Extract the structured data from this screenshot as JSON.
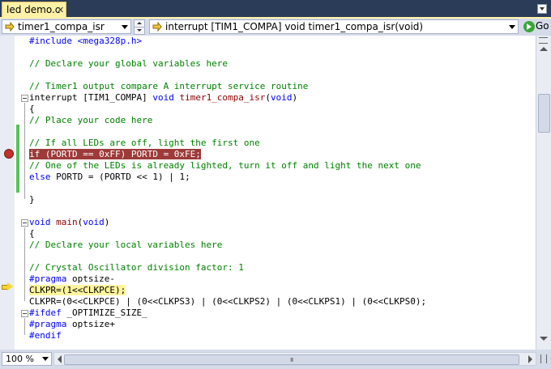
{
  "tab": {
    "title": "led demo.c",
    "close_glyph": "✕"
  },
  "navigation": {
    "left_combo": "timer1_compa_isr",
    "right_combo": "interrupt [TIM1_COMPA] void timer1_compa_isr(void)",
    "go_label": "Go"
  },
  "editor": {
    "lines": [
      [
        {
          "t": "#include <mega328p.h>",
          "c": "pp"
        }
      ],
      [],
      [
        {
          "t": "// Declare your global variables here",
          "c": "cm"
        }
      ],
      [],
      [
        {
          "t": "// Timer1 output compare A interrupt service routine",
          "c": "cm"
        }
      ],
      [
        {
          "t": "interrupt [TIM1_COMPA] ",
          "c": ""
        },
        {
          "t": "void",
          "c": "kw"
        },
        {
          "t": " ",
          "c": ""
        },
        {
          "t": "timer1_compa_isr",
          "c": "fn"
        },
        {
          "t": "(",
          "c": ""
        },
        {
          "t": "void",
          "c": "kw"
        },
        {
          "t": ")",
          "c": ""
        }
      ],
      [
        {
          "t": "{",
          "c": ""
        }
      ],
      [
        {
          "t": "// Place your code here",
          "c": "cm"
        }
      ],
      [],
      [
        {
          "t": "// If all LEDs are off, light the first one",
          "c": "cm"
        }
      ],
      [
        {
          "t": "if (PORTD == 0xFF) PORTD = 0xFE;",
          "c": "bp"
        }
      ],
      [
        {
          "t": "// One of the LEDs is already lighted, turn it off and light the next one",
          "c": "cm"
        }
      ],
      [
        {
          "t": "else",
          "c": "kw"
        },
        {
          "t": " PORTD = (PORTD << 1) | 1;",
          "c": ""
        }
      ],
      [],
      [
        {
          "t": "}",
          "c": ""
        }
      ],
      [],
      [
        {
          "t": "void",
          "c": "kw"
        },
        {
          "t": " ",
          "c": ""
        },
        {
          "t": "main",
          "c": "fn"
        },
        {
          "t": "(",
          "c": ""
        },
        {
          "t": "void",
          "c": "kw"
        },
        {
          "t": ")",
          "c": ""
        }
      ],
      [
        {
          "t": "{",
          "c": ""
        }
      ],
      [
        {
          "t": "// Declare your local variables here",
          "c": "cm"
        }
      ],
      [],
      [
        {
          "t": "// Crystal Oscillator division factor: 1",
          "c": "cm"
        }
      ],
      [
        {
          "t": "#pragma",
          "c": "pp"
        },
        {
          "t": " optsize-",
          "c": ""
        }
      ],
      [
        {
          "t": "CLKPR=(1<<CLKPCE);",
          "c": "cur"
        }
      ],
      [
        {
          "t": "CLKPR=(0<<CLKPCE) | (0<<CLKPS3) | (0<<CLKPS2) | (0<<CLKPS1) | (0<<CLKPS0);",
          "c": ""
        }
      ],
      [
        {
          "t": "#ifdef",
          "c": "pp"
        },
        {
          "t": " _OPTIMIZE_SIZE_",
          "c": ""
        }
      ],
      [
        {
          "t": "#pragma",
          "c": "pp"
        },
        {
          "t": " optsize+",
          "c": ""
        }
      ],
      [
        {
          "t": "#endif",
          "c": "pp"
        }
      ]
    ]
  },
  "status": {
    "zoom": "100 %",
    "hscroll_grip": "III"
  },
  "colors": {
    "breakpoint_line": "#9d3a3a",
    "current_line": "#fff59d",
    "keyword": "#0000ff",
    "comment": "#008000",
    "function": "#8b0000",
    "change_bar": "#57c35a"
  },
  "icons": {
    "breakpoint": "breakpoint-icon",
    "current_statement": "current-line-arrow-icon",
    "go": "go-icon",
    "scope": "scope-icon"
  }
}
